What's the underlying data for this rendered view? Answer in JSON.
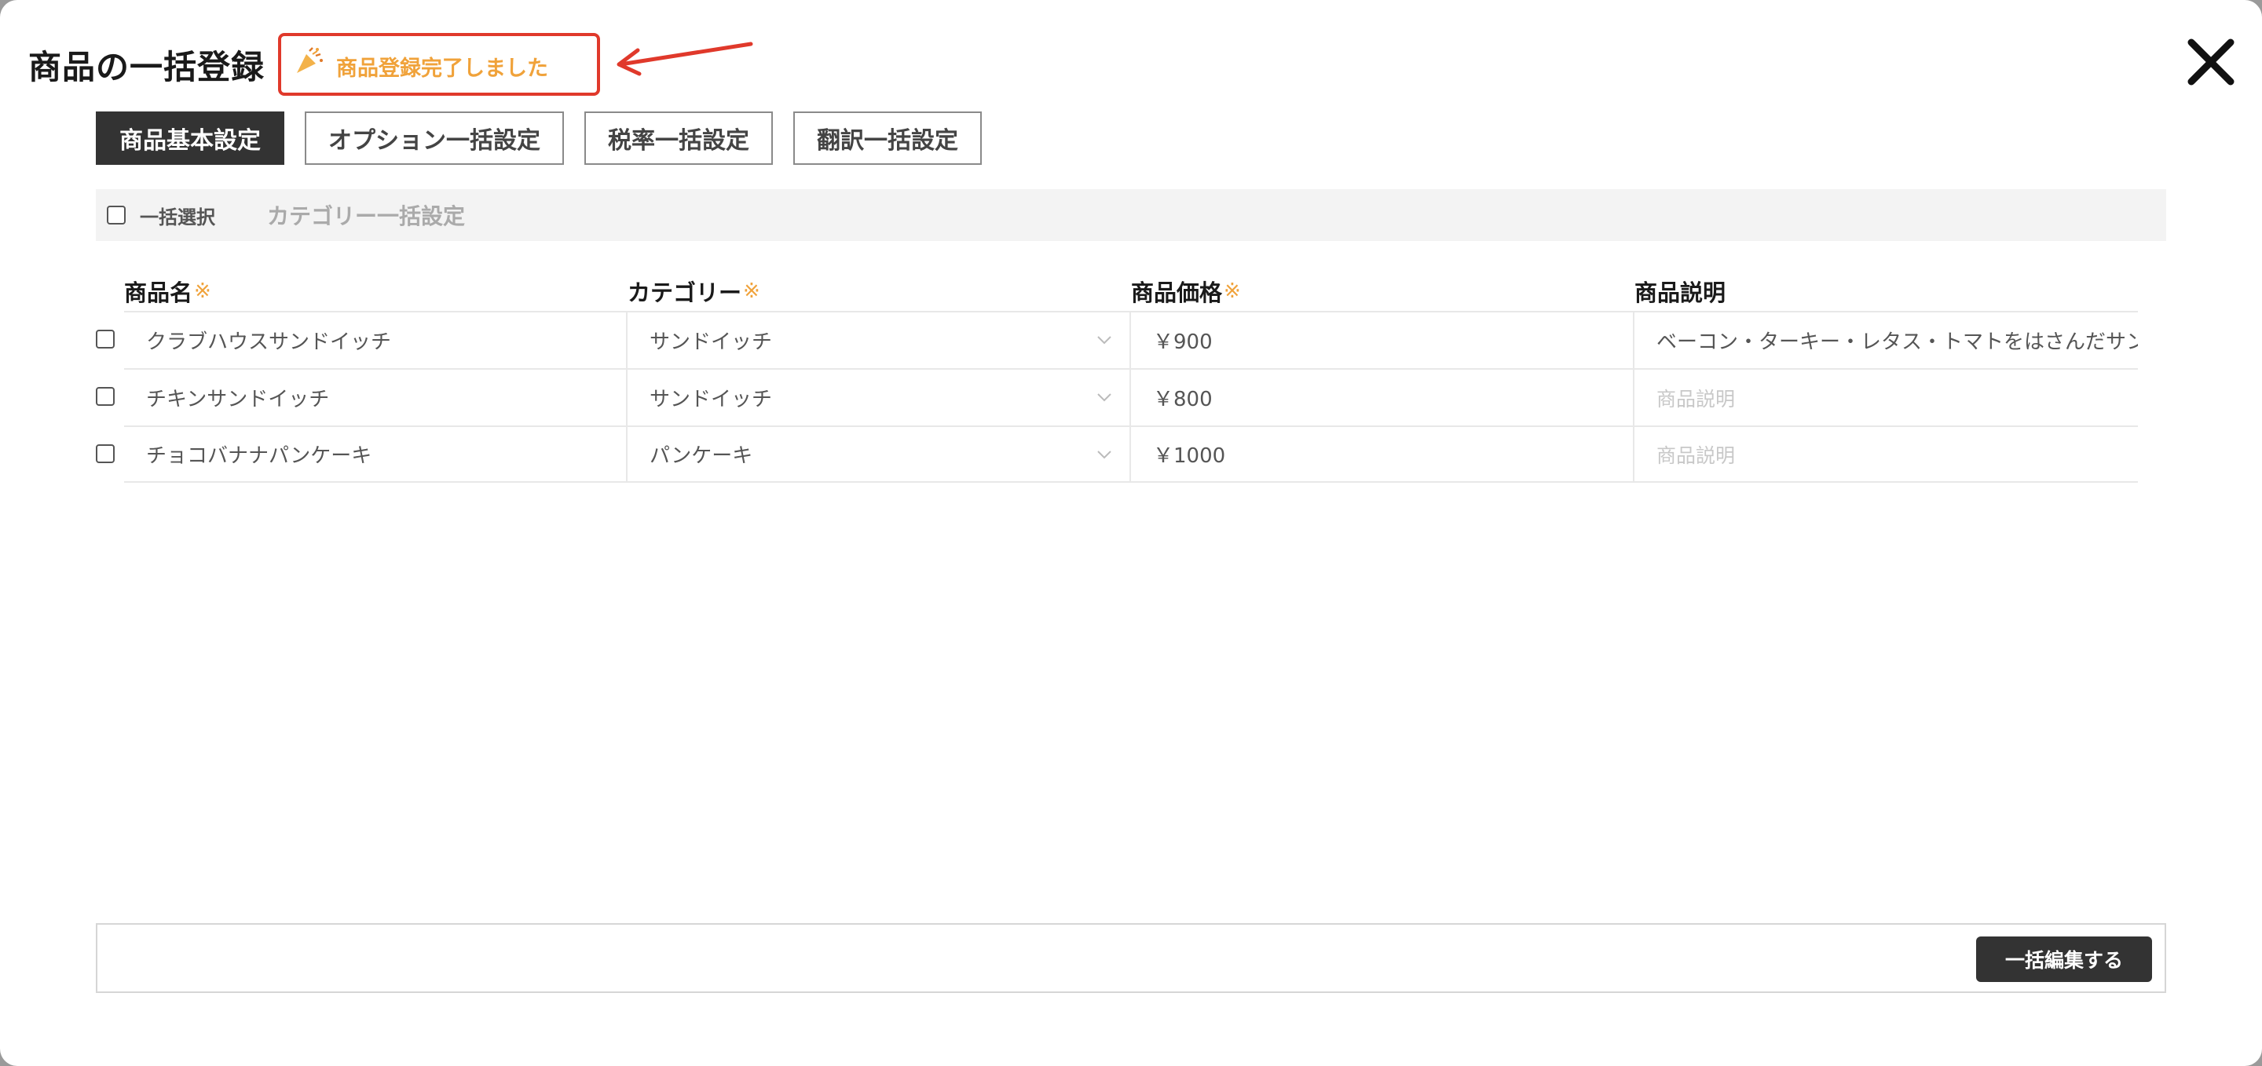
{
  "dialog": {
    "title": "商品の一括登録",
    "toast_message": "商品登録完了しました",
    "close_icon": "close-icon"
  },
  "tabs": [
    {
      "label": "商品基本設定",
      "active": true
    },
    {
      "label": "オプション一括設定",
      "active": false
    },
    {
      "label": "税率一括設定",
      "active": false
    },
    {
      "label": "翻訳一括設定",
      "active": false
    }
  ],
  "bulk_bar": {
    "select_all_label": "一括選択",
    "category_bulk_label": "カテゴリー一括設定"
  },
  "table": {
    "columns": [
      {
        "label": "商品名",
        "required_mark": "※"
      },
      {
        "label": "カテゴリー",
        "required_mark": "※"
      },
      {
        "label": "商品価格",
        "required_mark": "※"
      },
      {
        "label": "商品説明",
        "required_mark": ""
      }
    ],
    "rows": [
      {
        "name": "クラブハウスサンドイッチ",
        "category": "サンドイッチ",
        "price": "￥900",
        "description": "ベーコン・ターキー・レタス・トマトをはさんだサン",
        "description_is_placeholder": false
      },
      {
        "name": "チキンサンドイッチ",
        "category": "サンドイッチ",
        "price": "￥800",
        "description": "商品説明",
        "description_is_placeholder": true
      },
      {
        "name": "チョコバナナパンケーキ",
        "category": "パンケーキ",
        "price": "￥1000",
        "description": "商品説明",
        "description_is_placeholder": true
      }
    ]
  },
  "footer": {
    "bulk_edit_label": "一括編集する"
  },
  "colors": {
    "accent_orange": "#f0a23a",
    "annotation_red": "#e0392b",
    "dark_button": "#333333"
  }
}
